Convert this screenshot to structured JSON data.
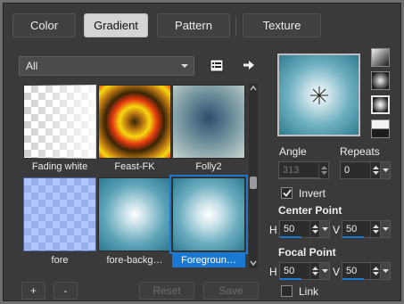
{
  "tabs": [
    {
      "label": "Color"
    },
    {
      "label": "Gradient"
    },
    {
      "label": "Pattern"
    },
    {
      "label": "Texture"
    }
  ],
  "active_tab": "Gradient",
  "category_dropdown": {
    "value": "All"
  },
  "gradients": [
    {
      "label": "Fading white",
      "selected": false
    },
    {
      "label": "Feast-FK",
      "selected": false
    },
    {
      "label": "Folly2",
      "selected": false
    },
    {
      "label": "fore",
      "selected": false
    },
    {
      "label": "fore-backg…",
      "selected": false
    },
    {
      "label": "Foregroun…",
      "selected": true
    }
  ],
  "buttons": {
    "add": "+",
    "remove": "-",
    "reset": "Reset",
    "save": "Save"
  },
  "settings": {
    "angle_label": "Angle",
    "angle_value": "313",
    "repeats_label": "Repeats",
    "repeats_value": "0",
    "invert_label": "Invert",
    "invert_checked": true,
    "center_point_label": "Center Point",
    "center_h_label": "H",
    "center_h_value": "50",
    "center_v_label": "V",
    "center_v_value": "50",
    "focal_point_label": "Focal Point",
    "focal_h_label": "H",
    "focal_h_value": "50",
    "focal_v_label": "V",
    "focal_v_value": "50",
    "link_label": "Link",
    "link_checked": false
  },
  "colors": {
    "accent": "#1a7ad3",
    "gradient_dark": "#2f7b91",
    "gradient_light": "#f7fcfc"
  }
}
